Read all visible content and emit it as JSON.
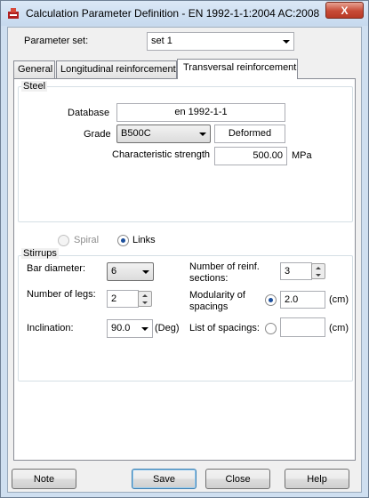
{
  "window": {
    "title": "Calculation Parameter Definition - EN 1992-1-1:2004 AC:2008",
    "close_label": "X"
  },
  "parameter_set": {
    "label": "Parameter set:",
    "value": "set 1"
  },
  "tabs": [
    {
      "label": "General",
      "active": false
    },
    {
      "label": "Longitudinal reinforcement",
      "active": false
    },
    {
      "label": "Transversal reinforcement",
      "active": true
    }
  ],
  "steel": {
    "group_label": "Steel",
    "database_label": "Database",
    "database_value": "en 1992-1-1",
    "grade_label": "Grade",
    "grade_value": "B500C",
    "bar_type": "Deformed",
    "char_strength_label": "Characteristic strength",
    "char_strength_value": "500.00",
    "char_strength_unit": "MPa"
  },
  "type": {
    "spiral_label": "Spiral",
    "links_label": "Links",
    "selected": "Links"
  },
  "stirrups": {
    "group_label": "Stirrups",
    "bar_diameter_label": "Bar diameter:",
    "bar_diameter_value": "6",
    "num_legs_label": "Number of legs:",
    "num_legs_value": "2",
    "inclination_label": "Inclination:",
    "inclination_value": "90.0",
    "inclination_unit": "(Deg)",
    "num_sections_label_1": "Number of reinf.",
    "num_sections_label_2": "sections:",
    "num_sections_value": "3",
    "modularity_label_1": "Modularity of",
    "modularity_label_2": "spacings",
    "modularity_value": "2.0",
    "modularity_unit": "(cm)",
    "modularity_selected": true,
    "list_spacings_label": "List of spacings:",
    "list_spacings_value": "",
    "list_spacings_unit": "(cm)",
    "list_spacings_selected": false
  },
  "buttons": {
    "note": "Note",
    "save": "Save",
    "close": "Close",
    "help": "Help"
  }
}
